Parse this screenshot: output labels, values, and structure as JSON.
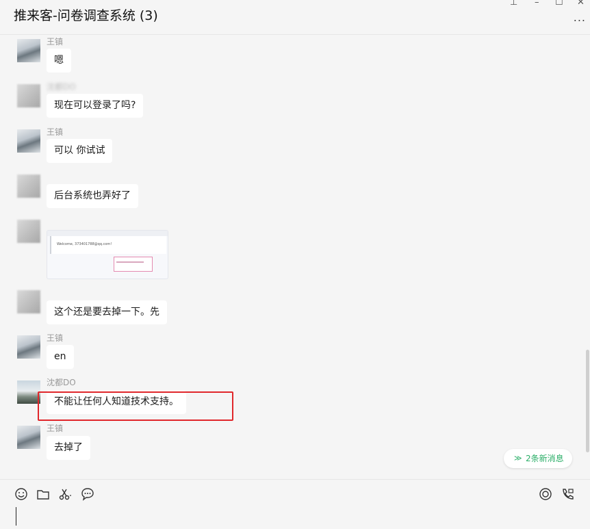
{
  "window": {
    "title": "推来客-问卷调查系统 (3)",
    "more_glyph": "...",
    "pin_glyph": "⊥",
    "minimize_glyph": "–",
    "maximize_glyph": "☐",
    "close_glyph": "✕"
  },
  "messages": [
    {
      "sender": "王镇",
      "text": "嗯"
    },
    {
      "sender": "沈都DO",
      "text": "现在可以登录了吗?"
    },
    {
      "sender": "王镇",
      "text": "可以 你试试"
    },
    {
      "sender": "",
      "text": "后台系统也弄好了"
    },
    {
      "sender": "",
      "image_text": "Welcome, 373401788@qq.com!"
    },
    {
      "sender": "",
      "text": "这个还是要去掉一下。先"
    },
    {
      "sender": "王镇",
      "text": "en"
    },
    {
      "sender": "沈都DO",
      "text": "不能让任何人知道技术支持。"
    },
    {
      "sender": "王镇",
      "text": "去掉了"
    }
  ],
  "new_messages": {
    "label": "2条新消息",
    "chevron": "≫"
  },
  "toolbar": {
    "icons": [
      "emoji-icon",
      "folder-icon",
      "scissors-icon",
      "chat-history-icon",
      "live-icon",
      "video-call-icon"
    ]
  },
  "colors": {
    "accent_green": "#2aae67",
    "highlight_red": "#e0262a",
    "bubble": "#ffffff",
    "background": "#f5f5f5"
  }
}
